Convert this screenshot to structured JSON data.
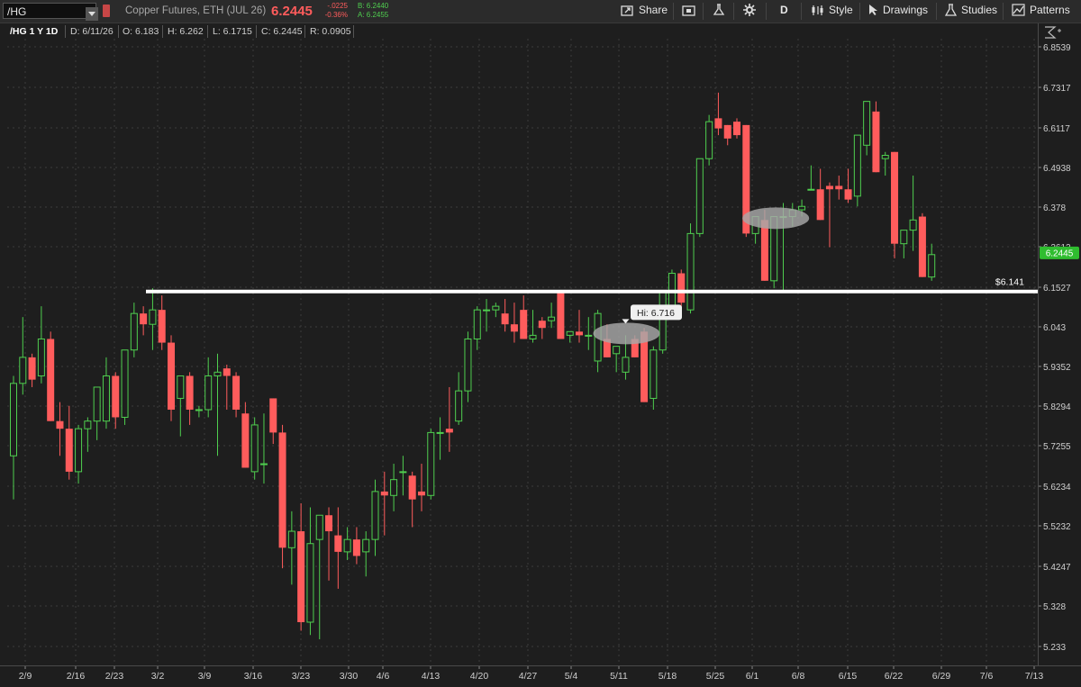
{
  "toolbar": {
    "symbol": "/HG",
    "description": "Copper Futures, ETH (JUL 26)",
    "last_price": "6.2445",
    "change": "-.0225",
    "change_pct": "-0.36%",
    "bid": "B: 6.2440",
    "ask": "A: 6.2455",
    "share_label": "Share",
    "period_label": "D",
    "style_label": "Style",
    "drawings_label": "Drawings",
    "studies_label": "Studies",
    "patterns_label": "Patterns"
  },
  "info_bar": {
    "symbol_period": "/HG 1 Y 1D",
    "date": "D: 6/11/26",
    "open": "O: 6.183",
    "high": "H: 6.262",
    "low": "L: 6.1715",
    "close": "C: 6.2445",
    "range": "R: 0.0905"
  },
  "colors": {
    "up": "#4fcf4f",
    "down": "#ff5c5c",
    "background": "#1e1e1e",
    "grid": "#3c3c3c",
    "horizontal_line": "#ffffff",
    "highlight_ellipse": "#9a9a9a"
  },
  "chart_data": {
    "type": "candlestick",
    "y_ticks": [
      "6.8539",
      "6.7317",
      "6.6117",
      "6.4938",
      "6.378",
      "6.2612",
      "6.1527",
      "6.043",
      "5.9352",
      "5.8294",
      "5.7255",
      "5.6234",
      "5.5232",
      "5.4247",
      "5.328",
      "5.233"
    ],
    "y_range": [
      5.2,
      6.89
    ],
    "x_labels": [
      "2/9",
      "2/16",
      "2/23",
      "3/2",
      "3/9",
      "3/16",
      "3/23",
      "3/30",
      "4/6",
      "4/13",
      "4/20",
      "4/27",
      "5/4",
      "5/11",
      "5/18",
      "5/25",
      "6/1",
      "6/8",
      "6/15",
      "6/22",
      "6/29",
      "7/6",
      "7/13"
    ],
    "dates": [
      "2/9",
      "2/10",
      "2/11",
      "2/12",
      "2/13",
      "2/16",
      "2/17",
      "2/18",
      "2/19",
      "2/20",
      "2/23",
      "2/24",
      "2/25",
      "2/26",
      "2/27",
      "3/2",
      "3/3",
      "3/4",
      "3/5",
      "3/6",
      "3/9",
      "3/10",
      "3/11",
      "3/12",
      "3/13",
      "3/16",
      "3/17",
      "3/18",
      "3/19",
      "3/20",
      "3/23",
      "3/24",
      "3/25",
      "3/26",
      "3/27",
      "3/30",
      "3/31",
      "4/1",
      "4/2",
      "4/3",
      "4/6",
      "4/7",
      "4/8",
      "4/9",
      "4/10",
      "4/13",
      "4/14",
      "4/15",
      "4/16",
      "4/17",
      "4/20",
      "4/21",
      "4/22",
      "4/23",
      "4/24",
      "4/27",
      "4/28",
      "4/29",
      "4/30",
      "5/1",
      "5/4",
      "5/5",
      "5/6",
      "5/7",
      "5/8",
      "5/11",
      "5/12",
      "5/13",
      "5/14",
      "5/15",
      "5/18",
      "5/19",
      "5/20",
      "5/21",
      "5/22",
      "5/25",
      "5/26",
      "5/27",
      "5/28",
      "5/29",
      "6/1",
      "6/2",
      "6/3",
      "6/4",
      "6/5",
      "6/8",
      "6/9",
      "6/10",
      "6/11"
    ],
    "ohlc": [
      [
        5.7,
        5.91,
        5.59,
        5.89
      ],
      [
        5.89,
        6.07,
        5.86,
        5.96
      ],
      [
        5.96,
        5.97,
        5.88,
        5.9
      ],
      [
        5.91,
        6.1,
        5.89,
        6.01
      ],
      [
        6.01,
        6.03,
        5.79,
        5.79
      ],
      [
        5.79,
        5.84,
        5.7,
        5.77
      ],
      [
        5.77,
        5.83,
        5.64,
        5.66
      ],
      [
        5.66,
        5.78,
        5.63,
        5.77
      ],
      [
        5.77,
        5.8,
        5.71,
        5.79
      ],
      [
        5.79,
        5.85,
        5.74,
        5.88
      ],
      [
        5.79,
        5.96,
        5.77,
        5.91
      ],
      [
        5.91,
        5.92,
        5.77,
        5.8
      ],
      [
        5.8,
        5.98,
        5.78,
        5.98
      ],
      [
        5.98,
        6.11,
        5.96,
        6.08
      ],
      [
        6.08,
        6.1,
        6.02,
        6.05
      ],
      [
        6.05,
        6.15,
        5.98,
        6.09
      ],
      [
        6.09,
        6.13,
        5.98,
        6.0
      ],
      [
        6.0,
        6.02,
        5.79,
        5.82
      ],
      [
        5.85,
        5.89,
        5.75,
        5.91
      ],
      [
        5.91,
        5.92,
        5.78,
        5.82
      ],
      [
        5.82,
        5.83,
        5.8,
        5.82
      ],
      [
        5.82,
        5.96,
        5.8,
        5.91
      ],
      [
        5.91,
        5.97,
        5.7,
        5.92
      ],
      [
        5.93,
        5.94,
        5.82,
        5.91
      ],
      [
        5.91,
        5.92,
        5.8,
        5.82
      ],
      [
        5.81,
        5.84,
        5.67,
        5.67
      ],
      [
        5.66,
        5.8,
        5.64,
        5.78
      ],
      [
        5.68,
        5.81,
        5.63,
        5.68
      ],
      [
        5.85,
        5.85,
        5.73,
        5.76
      ],
      [
        5.76,
        5.78,
        5.42,
        5.47
      ],
      [
        5.47,
        5.56,
        5.38,
        5.51
      ],
      [
        5.51,
        5.58,
        5.27,
        5.29
      ],
      [
        5.29,
        5.57,
        5.26,
        5.48
      ],
      [
        5.49,
        5.55,
        5.25,
        5.55
      ],
      [
        5.55,
        5.57,
        5.39,
        5.51
      ],
      [
        5.5,
        5.57,
        5.37,
        5.46
      ],
      [
        5.46,
        5.52,
        5.44,
        5.49
      ],
      [
        5.49,
        5.52,
        5.43,
        5.45
      ],
      [
        5.46,
        5.51,
        5.4,
        5.49
      ],
      [
        5.49,
        5.64,
        5.45,
        5.61
      ],
      [
        5.61,
        5.66,
        5.5,
        5.6
      ],
      [
        5.6,
        5.68,
        5.56,
        5.64
      ],
      [
        5.66,
        5.7,
        5.6,
        5.66
      ],
      [
        5.65,
        5.66,
        5.52,
        5.59
      ],
      [
        5.61,
        5.68,
        5.56,
        5.6
      ],
      [
        5.6,
        5.77,
        5.59,
        5.76
      ],
      [
        5.76,
        5.8,
        5.69,
        5.76
      ],
      [
        5.77,
        5.88,
        5.71,
        5.76
      ],
      [
        5.79,
        5.92,
        5.78,
        5.87
      ],
      [
        5.87,
        6.03,
        5.84,
        6.01
      ],
      [
        6.01,
        6.1,
        5.98,
        6.09
      ],
      [
        6.09,
        6.12,
        6.03,
        6.09
      ],
      [
        6.09,
        6.11,
        6.07,
        6.1
      ],
      [
        6.08,
        6.12,
        6.03,
        6.05
      ],
      [
        6.05,
        6.11,
        6.0,
        6.03
      ],
      [
        6.09,
        6.13,
        6.01,
        6.01
      ],
      [
        6.01,
        6.09,
        6.0,
        6.02
      ],
      [
        6.06,
        6.07,
        6.01,
        6.04
      ],
      [
        6.06,
        6.11,
        6.04,
        6.07
      ],
      [
        6.14,
        6.14,
        6.01,
        6.01
      ],
      [
        6.02,
        6.03,
        6.0,
        6.03
      ],
      [
        6.03,
        6.09,
        6.0,
        6.02
      ],
      [
        6.02,
        6.07,
        5.98,
        6.02
      ],
      [
        5.95,
        6.09,
        5.92,
        6.08
      ],
      [
        6.01,
        6.05,
        5.96,
        5.96
      ],
      [
        5.97,
        5.99,
        5.92,
        5.99
      ],
      [
        5.92,
        6.02,
        5.9,
        5.96
      ],
      [
        6.01,
        6.02,
        5.96,
        5.96
      ],
      [
        6.03,
        6.04,
        5.84,
        5.84
      ],
      [
        5.85,
        5.99,
        5.82,
        5.98
      ],
      [
        5.98,
        6.13,
        5.97,
        6.14
      ],
      [
        6.09,
        6.2,
        6.08,
        6.19
      ],
      [
        6.19,
        6.2,
        6.07,
        6.11
      ],
      [
        6.09,
        6.33,
        6.08,
        6.3
      ],
      [
        6.3,
        6.52,
        6.29,
        6.52
      ],
      [
        6.52,
        6.65,
        6.5,
        6.63
      ],
      [
        6.64,
        6.716,
        6.59,
        6.61
      ],
      [
        6.62,
        6.62,
        6.56,
        6.58
      ],
      [
        6.63,
        6.64,
        6.58,
        6.59
      ],
      [
        6.62,
        6.62,
        6.29,
        6.3
      ],
      [
        6.3,
        6.35,
        6.27,
        6.35
      ],
      [
        6.34,
        6.37,
        6.17,
        6.17
      ],
      [
        6.17,
        6.34,
        6.15,
        6.35
      ],
      [
        6.35,
        6.39,
        6.14,
        6.35
      ],
      [
        6.35,
        6.39,
        6.32,
        6.37
      ],
      [
        6.37,
        6.4,
        6.35,
        6.38
      ],
      [
        6.43,
        6.5,
        6.43,
        6.43
      ],
      [
        6.43,
        6.49,
        6.34,
        6.34
      ],
      [
        6.44,
        6.45,
        6.26,
        6.43
      ],
      [
        6.44,
        6.47,
        6.4,
        6.43
      ],
      [
        6.43,
        6.49,
        6.39,
        6.4
      ],
      [
        6.41,
        6.59,
        6.38,
        6.59
      ],
      [
        6.56,
        6.69,
        6.53,
        6.69
      ],
      [
        6.66,
        6.69,
        6.48,
        6.48
      ],
      [
        6.52,
        6.54,
        6.47,
        6.53
      ],
      [
        6.54,
        6.54,
        6.23,
        6.27
      ],
      [
        6.27,
        6.31,
        6.23,
        6.31
      ],
      [
        6.31,
        6.47,
        6.25,
        6.34
      ],
      [
        6.35,
        6.36,
        6.18,
        6.18
      ],
      [
        6.18,
        6.27,
        6.17,
        6.24
      ]
    ],
    "horizontal_line": {
      "value": 6.141,
      "label": "$6.141"
    },
    "high_marker": "Hi: 6.716",
    "current_price": "6.2445",
    "grid": true
  }
}
